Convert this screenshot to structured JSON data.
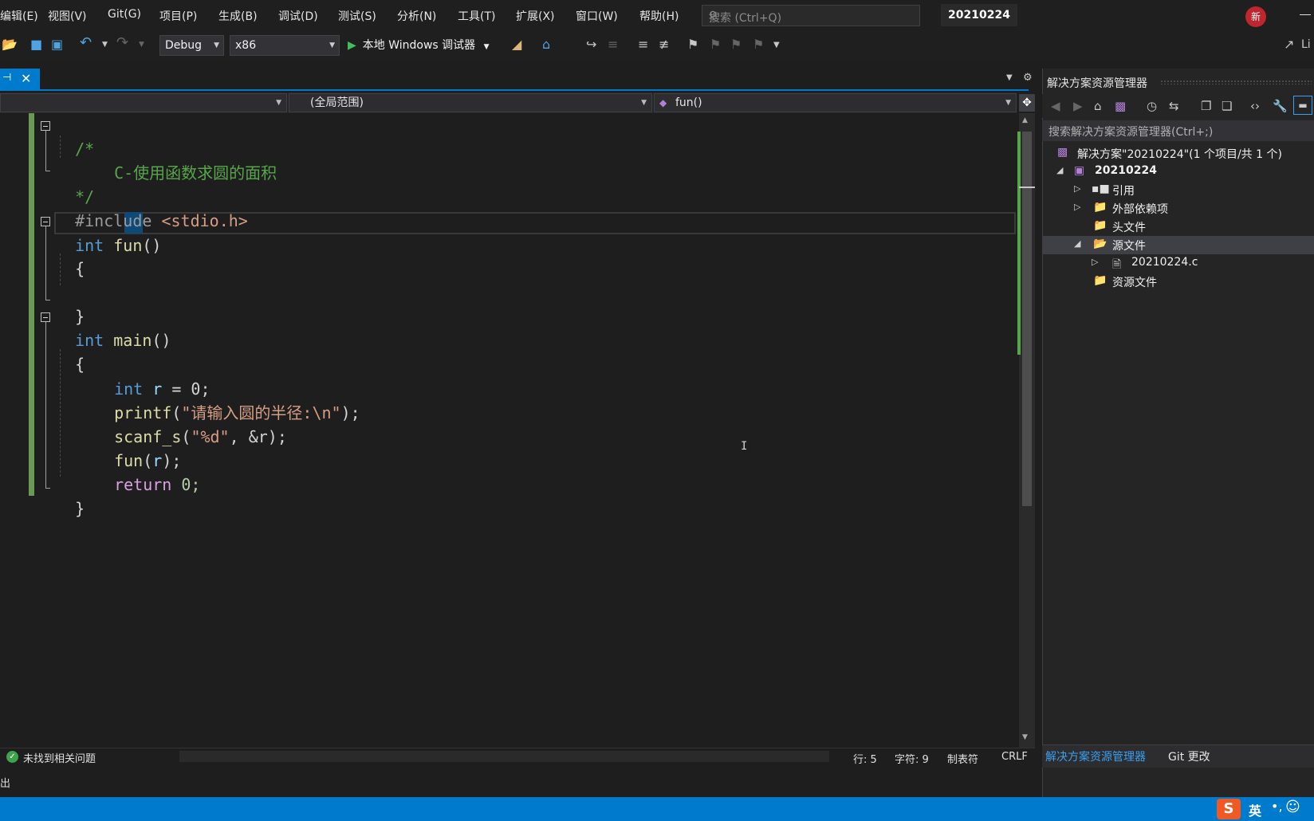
{
  "menu": [
    "编辑(E)",
    "视图(V)",
    "Git(G)",
    "项目(P)",
    "生成(B)",
    "调试(D)",
    "测试(S)",
    "分析(N)",
    "工具(T)",
    "扩展(X)",
    "窗口(W)",
    "帮助(H)"
  ],
  "search": {
    "placeholder": "搜索 (Ctrl+Q)"
  },
  "solution_name": "20210224",
  "badge": "新",
  "toolbar": {
    "config": "Debug",
    "platform": "x86",
    "run_label": "本地 Windows 调试器",
    "live_share": "Li"
  },
  "navbar": {
    "scope": "(全局范围)",
    "member": "fun()"
  },
  "code": {
    "comment_open": "/*",
    "comment_text": "C-使用函数求圆的面积",
    "comment_close": "*/",
    "include_directive": "#include",
    "include_file": "<stdio.h>",
    "kw_int": "int",
    "fun_name": "fun",
    "main_name": "main",
    "brace_open": "{",
    "brace_close": "}",
    "var_r": "r",
    "assign_zero": " = 0;",
    "printf": "printf",
    "printf_arg": "\"请输入圆的半径:\\n\"",
    "scanf": "scanf_s",
    "scanf_fmt": "\"%d\"",
    "scanf_rest": ", &r);",
    "fun_call": "fun",
    "return_kw": "return",
    "return_val": " 0;",
    "cursor_glyph": "I"
  },
  "status": {
    "issues": "未找到相关问题",
    "line": "行: 5",
    "char": "字符: 9",
    "tabs": "制表符",
    "eol": "CRLF"
  },
  "output_label": "出",
  "solution_explorer": {
    "title": "解决方案资源管理器",
    "search_placeholder": "搜索解决方案资源管理器(Ctrl+;)",
    "tree": {
      "solution": "解决方案\"20210224\"(1 个项目/共 1 个)",
      "project": "20210224",
      "references": "引用",
      "external_deps": "外部依赖项",
      "headers": "头文件",
      "sources": "源文件",
      "source_file": "20210224.c",
      "resources": "资源文件"
    },
    "tabs": {
      "active": "解决方案资源管理器",
      "git": "Git 更改"
    }
  },
  "ime": {
    "logo": "S",
    "lang": "英",
    "punct": "•,",
    "emoji": "☺"
  },
  "colors": {
    "accent": "#007acc",
    "comment": "#57a64a",
    "keyword": "#569cd6",
    "string": "#d69d85"
  }
}
